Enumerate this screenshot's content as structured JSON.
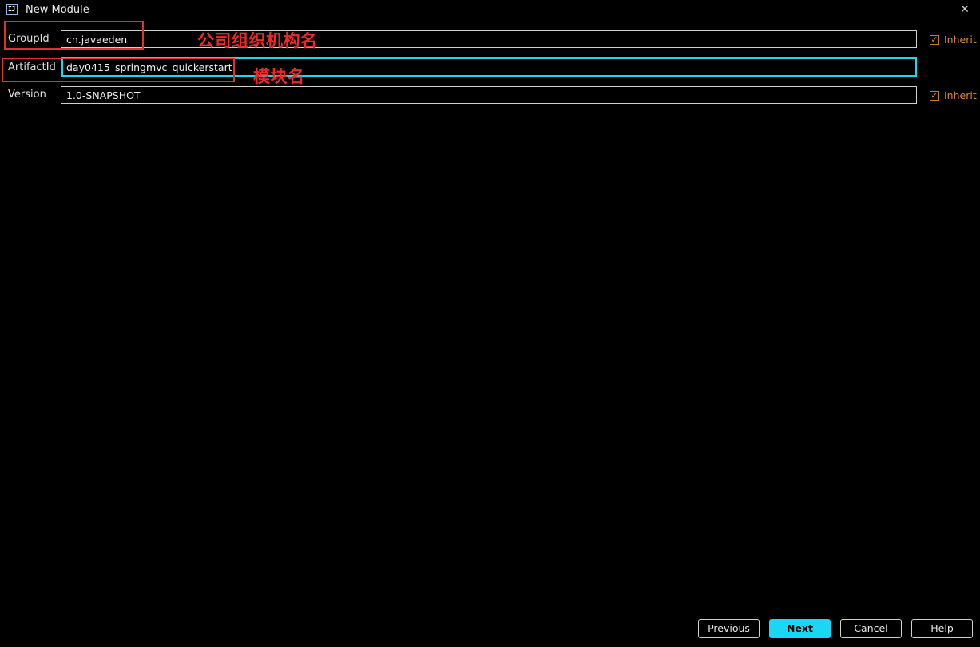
{
  "window": {
    "title": "New Module",
    "icon": "intellij-icon",
    "icon_text": "IJ",
    "close": "✕"
  },
  "fields": {
    "group_id": {
      "label": "GroupId",
      "value": "cn.javaeden"
    },
    "artifact_id": {
      "label": "ArtifactId",
      "value": "day0415_springmvc_quickerstart"
    },
    "version": {
      "label": "Version",
      "value": "1.0-SNAPSHOT"
    }
  },
  "inherit": {
    "label": "Inherit",
    "check": "✓"
  },
  "annotations": {
    "group": "公司组织机构名",
    "artifact": "模块名"
  },
  "buttons": {
    "previous": "Previous",
    "next": "Next",
    "cancel": "Cancel",
    "help": "Help"
  },
  "colors": {
    "accent": "#1ad8f5",
    "annotation": "#ec2a2a",
    "inherit": "#d98b34",
    "background": "#000000"
  }
}
